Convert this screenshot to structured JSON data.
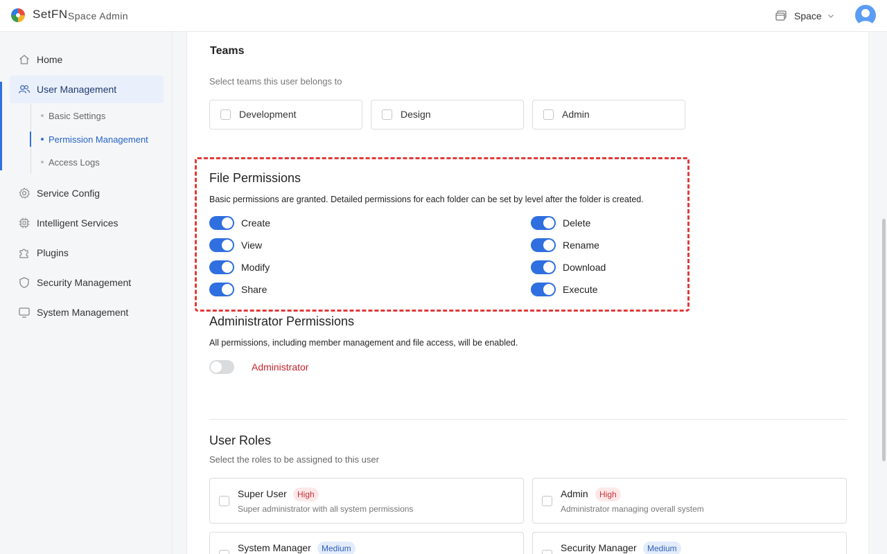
{
  "header": {
    "brand": "SetFN",
    "app_title": "Space Admin",
    "space_label": "Space"
  },
  "sidebar": {
    "items": [
      {
        "label": "Home",
        "icon": "home-icon"
      },
      {
        "label": "User Management",
        "icon": "users-icon",
        "active": true
      },
      {
        "label": "Service Config",
        "icon": "gear-icon"
      },
      {
        "label": "Intelligent Services",
        "icon": "chip-icon"
      },
      {
        "label": "Plugins",
        "icon": "puzzle-icon"
      },
      {
        "label": "Security Management",
        "icon": "shield-icon"
      },
      {
        "label": "System Management",
        "icon": "monitor-icon"
      }
    ],
    "sub_items": [
      {
        "label": "Basic Settings"
      },
      {
        "label": "Permission Management",
        "active": true
      },
      {
        "label": "Access Logs"
      }
    ]
  },
  "teams": {
    "title": "Teams",
    "subtitle": "Select teams this user belongs to",
    "options": [
      "Development",
      "Design",
      "Admin"
    ]
  },
  "file_permissions": {
    "title": "File Permissions",
    "description": "Basic permissions are granted. Detailed permissions for each folder can be set by level after the folder is created.",
    "left": [
      {
        "label": "Create",
        "on": true
      },
      {
        "label": "View",
        "on": true
      },
      {
        "label": "Modify",
        "on": true
      },
      {
        "label": "Share",
        "on": true
      }
    ],
    "right": [
      {
        "label": "Delete",
        "on": true
      },
      {
        "label": "Rename",
        "on": true
      },
      {
        "label": "Download",
        "on": true
      },
      {
        "label": "Execute",
        "on": true
      }
    ]
  },
  "admin_permissions": {
    "title": "Administrator Permissions",
    "description": "All permissions, including member management and file access, will be enabled.",
    "toggle_label": "Administrator",
    "on": false
  },
  "user_roles": {
    "title": "User Roles",
    "subtitle": "Select the roles to be assigned to this user",
    "roles": [
      {
        "name": "Super User",
        "level": "High",
        "description": "Super administrator with all system permissions"
      },
      {
        "name": "Admin",
        "level": "High",
        "description": "Administrator managing overall system"
      },
      {
        "name": "System Manager",
        "level": "Medium",
        "description": ""
      },
      {
        "name": "Security Manager",
        "level": "Medium",
        "description": ""
      }
    ]
  },
  "colors": {
    "accent": "#2f6fdf",
    "highlight_border": "#e03a3a",
    "danger_text": "#c8242c"
  }
}
